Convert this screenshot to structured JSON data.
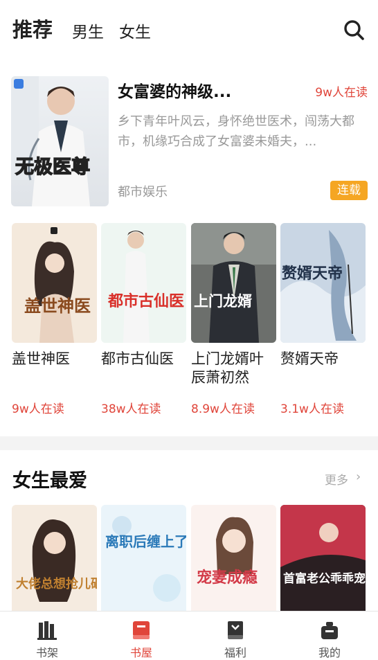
{
  "top_tabs": [
    {
      "label": "推荐",
      "active": true
    },
    {
      "label": "男生",
      "active": false
    },
    {
      "label": "女生",
      "active": false
    }
  ],
  "featured": {
    "title": "女富婆的神级...",
    "readers": "9w人在读",
    "description": "乡下青年叶风云，身怀绝世医术，闯荡大都市，机缘巧合成了女富婆未婚夫，...",
    "category": "都市娱乐",
    "status": "连载",
    "cover_text": "无极医尊"
  },
  "grid_books": [
    {
      "title": "盖世神医",
      "readers": "9w人在读",
      "cover_text": "盖世神医"
    },
    {
      "title": "都市古仙医",
      "readers": "38w人在读",
      "cover_text": "都市古仙医"
    },
    {
      "title": "上门龙婿叶辰萧初然",
      "readers": "8.9w人在读",
      "cover_text": "上门龙婿"
    },
    {
      "title": "赘婿天帝",
      "readers": "3.1w人在读",
      "cover_text": "赘婿天帝"
    }
  ],
  "female_section": {
    "title": "女生最爱",
    "more_label": "更多",
    "books": [
      {
        "cover_text": "大佬总想抢儿砸"
      },
      {
        "cover_text": "离职后缠上了"
      },
      {
        "cover_text": "宠妻成瘾"
      },
      {
        "cover_text": "首富老公乖乖宠我"
      }
    ]
  },
  "bottom_nav": [
    {
      "label": "书架",
      "icon": "bookshelf-icon",
      "active": false
    },
    {
      "label": "书屋",
      "icon": "bookstore-icon",
      "active": true
    },
    {
      "label": "福利",
      "icon": "welfare-icon",
      "active": false
    },
    {
      "label": "我的",
      "icon": "profile-icon",
      "active": false
    }
  ],
  "colors": {
    "accent": "#e0453a",
    "badge": "#f5a623"
  }
}
